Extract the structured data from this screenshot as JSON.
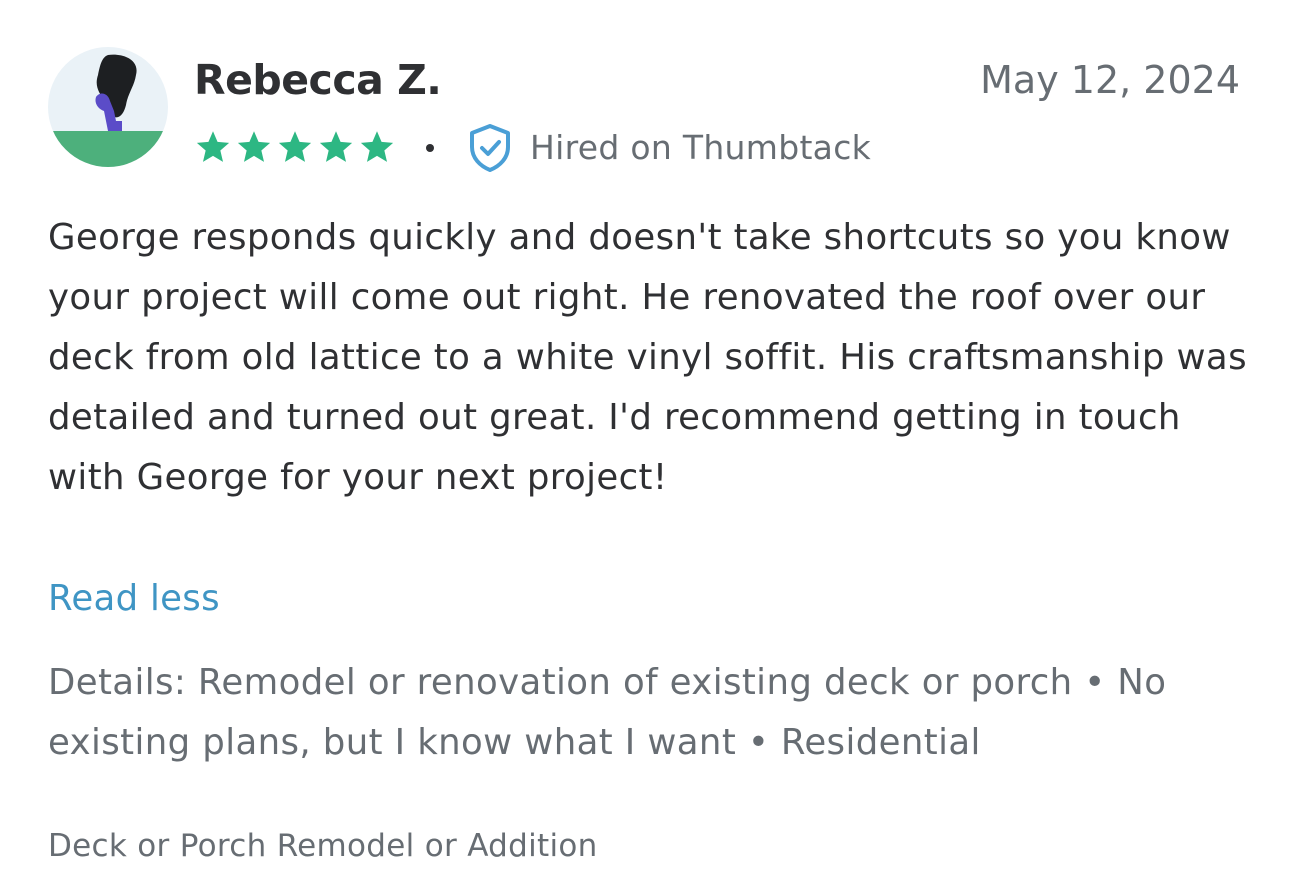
{
  "review": {
    "reviewer_name": "Rebecca Z.",
    "date": "May 12, 2024",
    "rating": 5,
    "rating_max": 5,
    "star_color": "#2db783",
    "separator": "•",
    "hired_badge_icon": "shield-check-icon",
    "hired_label": "Hired on Thumbtack",
    "body": "George responds quickly and doesn't take shortcuts so you know your project will come out right. He renovated the roof over our deck from old lattice to a white vinyl soffit. His craftsmanship was detailed and turned out great. I'd recommend getting in touch with George for your next project!",
    "read_less_label": "Read less",
    "details_text": "Details: Remodel or renovation of existing deck or porch • No existing plans, but I know what I want • Residential",
    "category": "Deck or Porch Remodel or Addition"
  },
  "colors": {
    "text_primary": "#2f3033",
    "text_secondary": "#676d73",
    "link": "#3f95c4",
    "badge_blue": "#4a9fd6"
  }
}
